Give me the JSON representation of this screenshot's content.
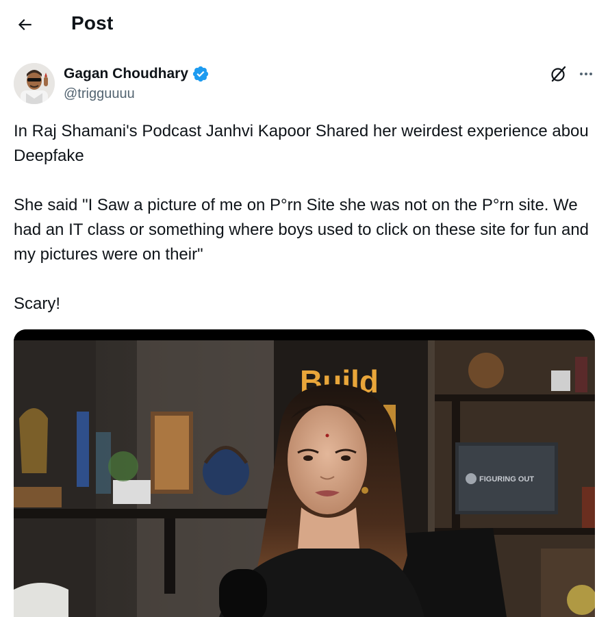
{
  "header": {
    "title": "Post"
  },
  "author": {
    "display_name": "Gagan Choudhary",
    "handle": "@trigguuuu",
    "verified_color": "#1d9bf0"
  },
  "tweet": {
    "paragraphs": [
      "In Raj Shamani's Podcast Janhvi Kapoor Shared her weirdest experience abou Deepfake",
      "She said \"I Saw a picture of me on P°rn Site she was not on the P°rn site. We had an IT class or something where boys used to click on these site for fun and my pictures were on their\"",
      "Scary!"
    ]
  },
  "media": {
    "sign_text": "Build",
    "screen_text": "FIGURING OUT"
  },
  "icons": {
    "back": "arrow-left-icon",
    "verified": "verified-badge-icon",
    "grok": "grok-icon",
    "more": "more-icon"
  }
}
